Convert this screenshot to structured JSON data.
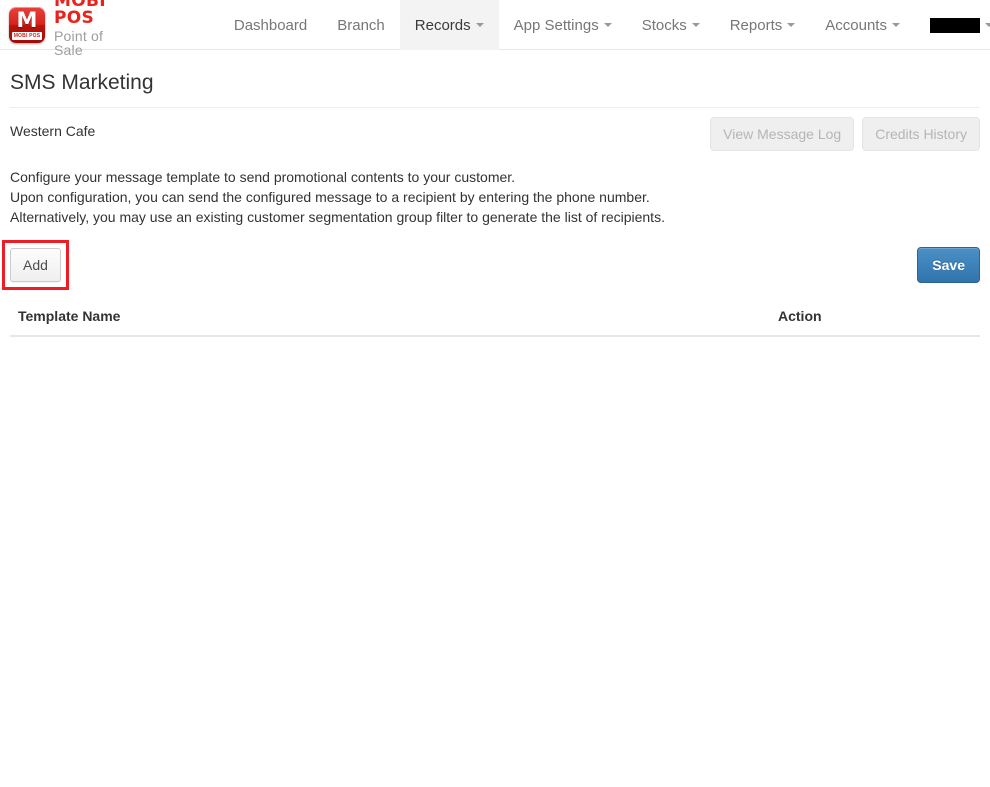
{
  "brand": {
    "logo_mark": "M",
    "logo_badge": "MOBI POS",
    "title": "MOBI POS",
    "subtitle": "Point of Sale",
    "accent_color": "#e8231b"
  },
  "navbar": {
    "items": [
      {
        "label": "Dashboard",
        "has_caret": false,
        "active": false
      },
      {
        "label": "Branch",
        "has_caret": false,
        "active": false
      },
      {
        "label": "Records",
        "has_caret": true,
        "active": true
      },
      {
        "label": "App Settings",
        "has_caret": true,
        "active": false
      },
      {
        "label": "Stocks",
        "has_caret": true,
        "active": false
      },
      {
        "label": "Reports",
        "has_caret": true,
        "active": false
      },
      {
        "label": "Accounts",
        "has_caret": true,
        "active": false
      }
    ],
    "account_label": "",
    "account_redacted": true
  },
  "page": {
    "title": "SMS Marketing",
    "store_name": "Western Cafe",
    "header_actions": [
      {
        "label": "View Message Log",
        "style": "muted"
      },
      {
        "label": "Credits History",
        "style": "muted"
      }
    ],
    "description": [
      "Configure your message template to send promotional contents to your customer.",
      "Upon configuration, you can send the configured message to a recipient by entering the phone number.",
      "Alternatively, you may use an existing customer segmentation group filter to generate the list of recipients."
    ],
    "add_button": "Add",
    "save_button": "Save",
    "highlight": {
      "target": "add-button",
      "color": "#ee1c25"
    }
  },
  "table": {
    "columns": [
      "Template Name",
      "Action"
    ],
    "rows": [],
    "empty": true
  }
}
